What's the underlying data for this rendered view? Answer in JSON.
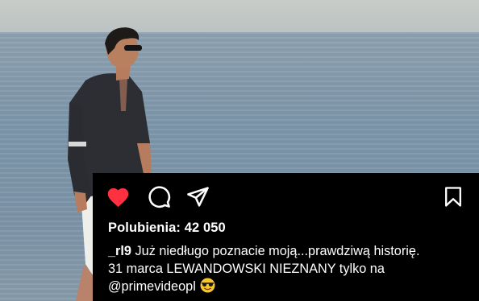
{
  "post": {
    "likes_label": "Polubienia:",
    "likes_count": "42 050",
    "caption": {
      "username": "_rl9",
      "line1_text": "Już niedługo poznacie moją...prawdziwą historię.",
      "line2": "31 marca LEWANDOWSKI NIEZNANY tylko na",
      "mention": "@primevideopl",
      "emoji": "😎"
    },
    "actions": {
      "like_icon": "heart-filled",
      "comment_icon": "speech-bubble",
      "share_icon": "paper-plane",
      "save_icon": "bookmark"
    },
    "colors": {
      "like": "#ff3040",
      "panel_bg": "#000000",
      "text": "#ffffff"
    }
  }
}
